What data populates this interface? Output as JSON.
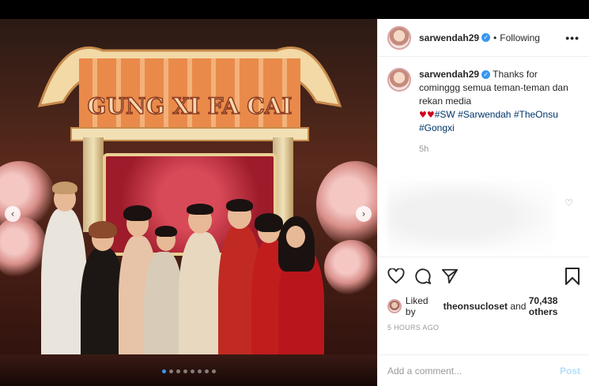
{
  "header": {
    "username": "sarwendah29",
    "verified_icon": "verified-badge-icon",
    "separator": "•",
    "follow_status": "Following",
    "more_label": "•••"
  },
  "photo": {
    "banner_text": "GUNG XI FA CAI",
    "prev_icon": "chevron-left-icon",
    "next_icon": "chevron-right-icon",
    "carousel_count": 8,
    "carousel_active": 1
  },
  "caption": {
    "username": "sarwendah29",
    "text_line1": "Thanks for cominggg",
    "text_line2": "semua teman-teman dan rekan media",
    "hearts": "♥♥",
    "tag1": "#SW",
    "tag2": "#Sarwendah",
    "tag3": "#TheOnsu",
    "tag4": "#Gongxi",
    "time": "5h"
  },
  "actions": {
    "like_icon": "heart-outline-icon",
    "comment_icon": "comment-icon",
    "share_icon": "paper-plane-icon",
    "save_icon": "bookmark-icon"
  },
  "likes": {
    "prefix": "Liked by",
    "user": "theonsucloset",
    "and": "and",
    "count": "70,438 others"
  },
  "time_ago": "5 HOURS AGO",
  "comment_box": {
    "placeholder": "Add a comment...",
    "post_label": "Post"
  },
  "colors": {
    "accent": "#3897f0",
    "hashtag": "#003569",
    "heart": "#d0021b",
    "post_disabled": "#b2dffc"
  }
}
